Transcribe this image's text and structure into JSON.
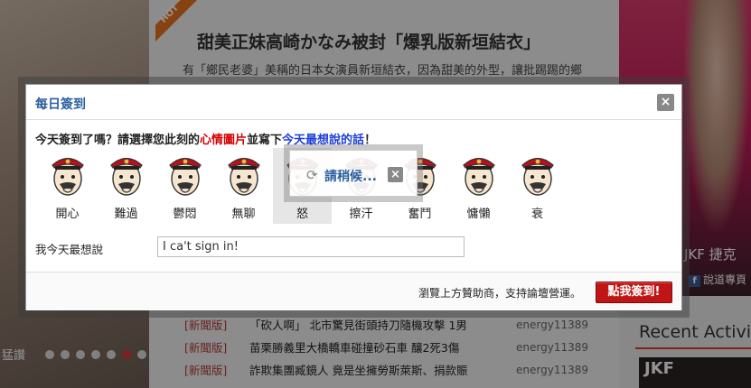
{
  "background": {
    "article": {
      "hot_badge": "HOT",
      "title": "甜美正妹高崎かなみ被封「爆乳版新垣結衣」",
      "excerpt": "有「鄉民老婆」美稱的日本女演員新垣結衣，因為甜美的外型，讓批踢踢的鄉"
    },
    "slider_caption": "猛讚",
    "news": [
      {
        "tag": "[新聞版]",
        "title": "「砍人啊」 北市驚見街頭持刀隨機攻擊 1男",
        "user": "energy11389"
      },
      {
        "tag": "[新聞版]",
        "title": "苗栗勝義里大橋轎車碰撞砂石車 釀2死3傷",
        "user": "energy11389"
      },
      {
        "tag": "[新聞版]",
        "title": "詐欺集團臧鏡人 竟是坐擁勞斯萊斯、捐款賑",
        "user": "energy11389"
      }
    ],
    "promo": {
      "line1": "JKF 捷克",
      "line2": "說道專頁"
    },
    "recent_title": "Recent Activi",
    "recent_thumb": "JKF"
  },
  "modal": {
    "title": "每日簽到",
    "close": "×",
    "prompt": {
      "part1": "今天簽到了嗎？請選擇您此刻的",
      "mood_link": "心情圖片",
      "part2": "並寫下",
      "say_link": "今天最想說的話",
      "part3": "！"
    },
    "moods": [
      {
        "label": "開心",
        "icon": "happy-face-icon",
        "selected": false
      },
      {
        "label": "難過",
        "icon": "sad-face-icon",
        "selected": false
      },
      {
        "label": "鬱悶",
        "icon": "gloomy-face-icon",
        "selected": false
      },
      {
        "label": "無聊",
        "icon": "bored-face-icon",
        "selected": false
      },
      {
        "label": "怒",
        "icon": "angry-face-icon",
        "selected": true
      },
      {
        "label": "擦汗",
        "icon": "sweat-face-icon",
        "selected": false
      },
      {
        "label": "奮鬥",
        "icon": "fight-face-icon",
        "selected": false
      },
      {
        "label": "慵懶",
        "icon": "lazy-face-icon",
        "selected": false
      },
      {
        "label": "衰",
        "icon": "unlucky-face-icon",
        "selected": false
      }
    ],
    "say_label": "我今天最想說",
    "say_value": "I ca't sign in!",
    "footer_note": "瀏覽上方贊助商，支持論壇營運。",
    "checkin_button": "點我簽到!"
  },
  "loading": {
    "text": "請稍候...",
    "close": "×"
  },
  "colors": {
    "accent_blue": "#2a5f9e",
    "accent_red": "#c01515",
    "mood_link_red": "#d40000",
    "say_link_blue": "#1d3fd6"
  }
}
